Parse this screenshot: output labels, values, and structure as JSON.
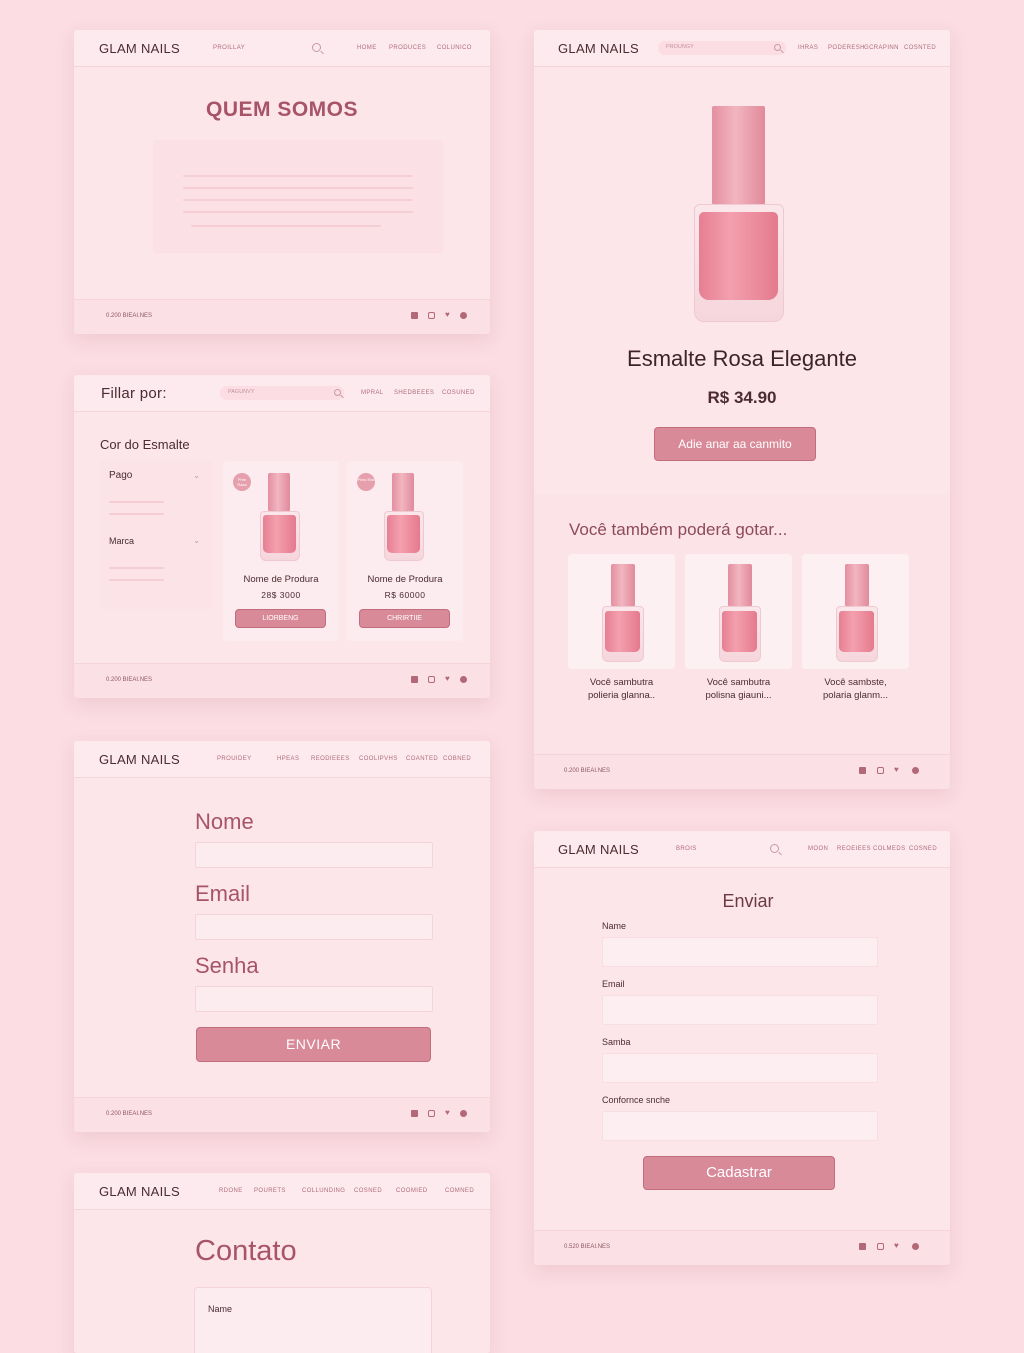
{
  "brand": "GLAM NAILS",
  "colors": {
    "background": "#fbdde3",
    "card": "#fde6ea",
    "accent": "#d98a99",
    "heading": "#a85468"
  },
  "icons": [
    "search-icon",
    "facebook-icon",
    "instagram-icon",
    "twitter-icon",
    "pinterest-icon"
  ],
  "footer_copy": "0.200 BIEAI.NES",
  "about": {
    "nav_left": "PROILLAY",
    "nav": [
      "HOME",
      "PRODUCES",
      "COLUNICO"
    ],
    "title": "QUEM SOMOS"
  },
  "filter": {
    "title": "Fillar por:",
    "search_placeholder": "PAGUNVY",
    "nav": [
      "MPRAL",
      "SHEDBEEES",
      "COSUNED"
    ],
    "section_title": "Cor do Esmalte",
    "filter1": "Pago",
    "filter2": "Marca",
    "products": [
      {
        "badge": "Prim Raza",
        "name": "Nome de Produra",
        "price": "28$ 3000",
        "button": "LIORBENG"
      },
      {
        "badge": "Pimc Elot",
        "name": "Nome de Produra",
        "price": "R$ 60000",
        "button": "CHRIRTIIE"
      }
    ]
  },
  "signup": {
    "nav": [
      "PROUIDEY",
      "HPEAS",
      "REODIEEES",
      "COOLIPVHS",
      "COANTED",
      "COBNED"
    ],
    "labels": [
      "Nome",
      "Email",
      "Senha"
    ],
    "button": "ENVIAR"
  },
  "contact": {
    "nav": [
      "RDONE",
      "POURETS",
      "COLLUNDING",
      "COSNED",
      "COOMIED",
      "COMNED"
    ],
    "title": "Contato",
    "field_label": "Name"
  },
  "product": {
    "search_placeholder": "PROUNGY",
    "nav": [
      "IHRAS",
      "PODERESH",
      "GCRAPINN",
      "COSNTED"
    ],
    "name": "Esmalte Rosa Elegante",
    "price": "R$ 34.90",
    "button": "Adie anar aa canmito",
    "related_title": "Você também poderá gotar...",
    "related": [
      {
        "line1": "Você sambutra",
        "line2": "polieria glanna.."
      },
      {
        "line1": "Você sambutra",
        "line2": "polisna giauni..."
      },
      {
        "line1": "Você sambste,",
        "line2": "polaria glanm..."
      }
    ],
    "footer_copy": "0.200 BIEAI.NES"
  },
  "register": {
    "nav_left": "BROIS",
    "nav": [
      "MOON",
      "REOEIEES",
      "COLMEDS",
      "COSNED"
    ],
    "title": "Enviar",
    "labels": [
      "Name",
      "Email",
      "Samba",
      "Confornce snche"
    ],
    "button": "Cadastrar",
    "footer_copy": "0.520 BIEAI.NES"
  }
}
